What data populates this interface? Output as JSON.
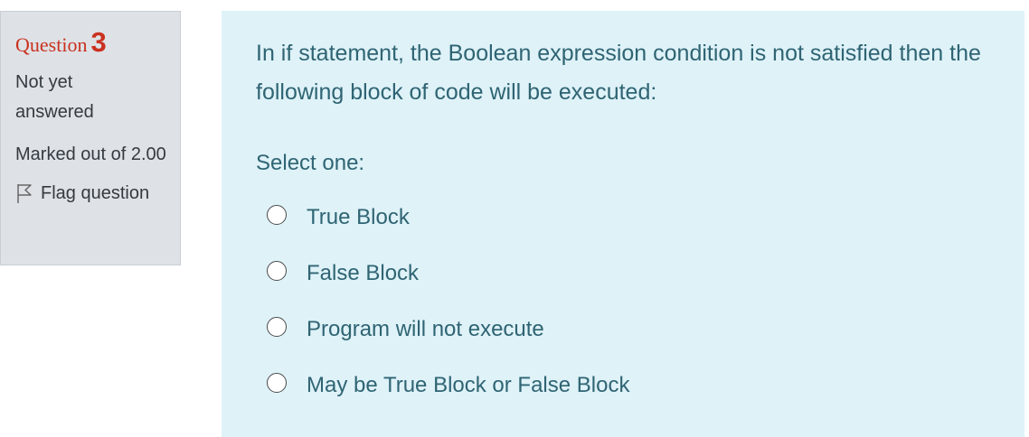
{
  "info": {
    "question_word": "Question",
    "question_number": "3",
    "state": "Not yet answered",
    "grade": "Marked out of 2.00",
    "flag_label": "Flag question"
  },
  "question": {
    "text": "In if statement, the Boolean expression condition is not satisfied then the following block of code will be executed:",
    "prompt": "Select one:",
    "options": [
      {
        "label": "True Block",
        "selected": false
      },
      {
        "label": "False Block",
        "selected": false
      },
      {
        "label": "Program will not execute",
        "selected": false
      },
      {
        "label": "May be True Block or False Block",
        "selected": false
      }
    ]
  },
  "colors": {
    "info_background": "#dee2e6",
    "content_background": "#def2f8",
    "question_number": "#ca3120",
    "content_text": "#2f6473"
  },
  "icons": {
    "flag": "flag-icon",
    "radio": "radio-button-unselected"
  }
}
